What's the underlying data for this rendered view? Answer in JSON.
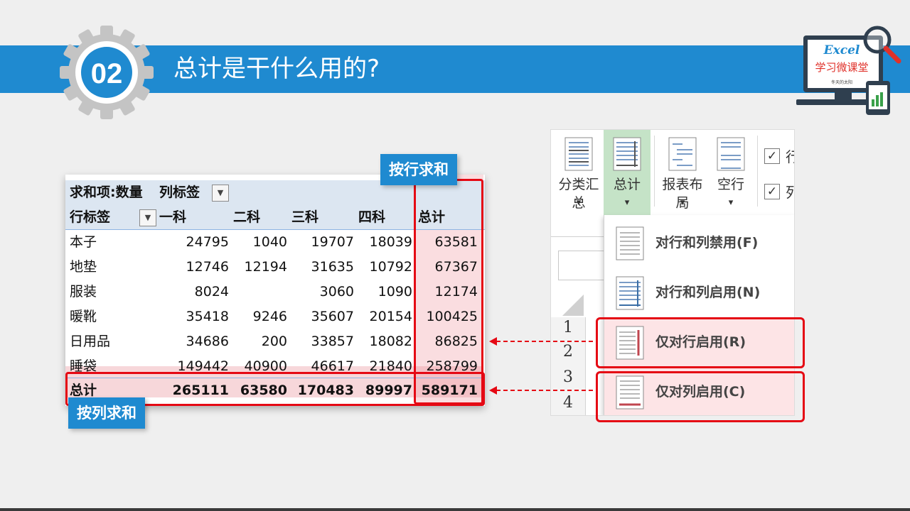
{
  "slide": {
    "badge": "02",
    "title": "总计是干什么用的?",
    "accent_color": "#1f8ad0",
    "highlight_color": "#e50914"
  },
  "logo": {
    "line1": "Excel",
    "line2": "学习微课堂",
    "sub": "冬天的太阳"
  },
  "pivot": {
    "value_field": "求和项:数量",
    "column_label": "列标签",
    "row_label": "行标签",
    "columns": [
      "一科",
      "二科",
      "三科",
      "四科",
      "总计"
    ],
    "rows": [
      {
        "label": "本子",
        "values": [
          "24795",
          "1040",
          "19707",
          "18039",
          "63581"
        ]
      },
      {
        "label": "地垫",
        "values": [
          "12746",
          "12194",
          "31635",
          "10792",
          "67367"
        ]
      },
      {
        "label": "服装",
        "values": [
          "8024",
          "",
          "3060",
          "1090",
          "12174"
        ]
      },
      {
        "label": "暖靴",
        "values": [
          "35418",
          "9246",
          "35607",
          "20154",
          "100425"
        ]
      },
      {
        "label": "日用品",
        "values": [
          "34686",
          "200",
          "33857",
          "18082",
          "86825"
        ]
      },
      {
        "label": "睡袋",
        "values": [
          "149442",
          "40900",
          "46617",
          "21840",
          "258799"
        ]
      }
    ],
    "total": {
      "label": "总计",
      "values": [
        "265111",
        "63580",
        "170483",
        "89997",
        "589171"
      ]
    }
  },
  "callouts": {
    "row_sum": "按行求和",
    "col_sum": "按列求和"
  },
  "ribbon": {
    "subtotals": "分类汇总",
    "grand_totals": "总计",
    "report_layout": "报表布局",
    "blank_rows": "空行",
    "check1": "行",
    "check2": "列",
    "menu": [
      {
        "label": "对行和列禁用(F)",
        "icon": "grand-totals-off-icon"
      },
      {
        "label": "对行和列启用(N)",
        "icon": "grand-totals-on-icon"
      },
      {
        "label": "仅对行启用(R)",
        "icon": "grand-totals-rows-only-icon"
      },
      {
        "label": "仅对列启用(C)",
        "icon": "grand-totals-columns-only-icon"
      }
    ],
    "row_numbers": [
      "1",
      "2",
      "3",
      "4"
    ]
  }
}
